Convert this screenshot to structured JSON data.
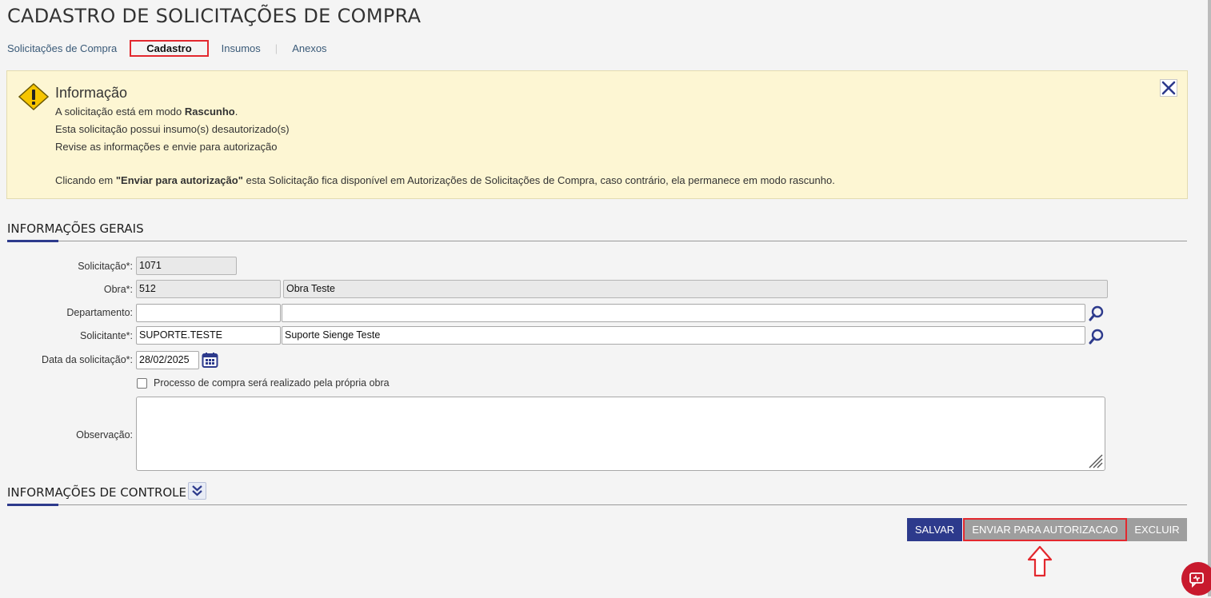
{
  "page": {
    "title": "CADASTRO DE SOLICITAÇÕES DE COMPRA"
  },
  "tabs": [
    {
      "label": "Solicitações de Compra",
      "active": false
    },
    {
      "label": "Cadastro",
      "active": true
    },
    {
      "label": "Insumos",
      "active": false
    },
    {
      "label": "Anexos",
      "active": false
    }
  ],
  "info": {
    "title": "Informação",
    "line1_prefix": "A solicitação está em modo ",
    "line1_bold": "Rascunho",
    "line1_suffix": ".",
    "line2": "Esta solicitação possui insumo(s) desautorizado(s)",
    "line3": "Revise as informações e envie para autorização",
    "line4_prefix": "Clicando em ",
    "line4_bold": "\"Enviar para autorização\"",
    "line4_suffix": " esta Solicitação fica disponível em Autorizações de Solicitações de Compra, caso contrário, ela permanece em modo rascunho.",
    "icons": {
      "warning": "warning-icon",
      "close": "close-icon"
    }
  },
  "general": {
    "section_title": "INFORMAÇÕES GERAIS",
    "solicitacao": {
      "label": "Solicitação*:",
      "value": "1071"
    },
    "obra": {
      "label": "Obra*:",
      "code": "512",
      "name": "Obra Teste"
    },
    "departamento": {
      "label": "Departamento:",
      "code": "",
      "name": ""
    },
    "solicitante": {
      "label": "Solicitante*:",
      "code": "SUPORTE.TESTE",
      "name": "Suporte Sienge Teste"
    },
    "data": {
      "label": "Data da solicitação*:",
      "value": "28/02/2025"
    },
    "processo": {
      "label": "Processo de compra será realizado pela própria obra",
      "checked": false
    },
    "observacao": {
      "label": "Observação:",
      "value": ""
    }
  },
  "control": {
    "section_title": "INFORMAÇÕES DE CONTROLE"
  },
  "actions": {
    "salvar": "SALVAR",
    "enviar": "ENVIAR PARA AUTORIZACAO",
    "excluir": "EXCLUIR"
  },
  "colors": {
    "primary": "#2d3a8c",
    "highlight": "#e3282e",
    "info_bg": "#fdf6d3",
    "disabled_btn": "#9e9e9e"
  }
}
